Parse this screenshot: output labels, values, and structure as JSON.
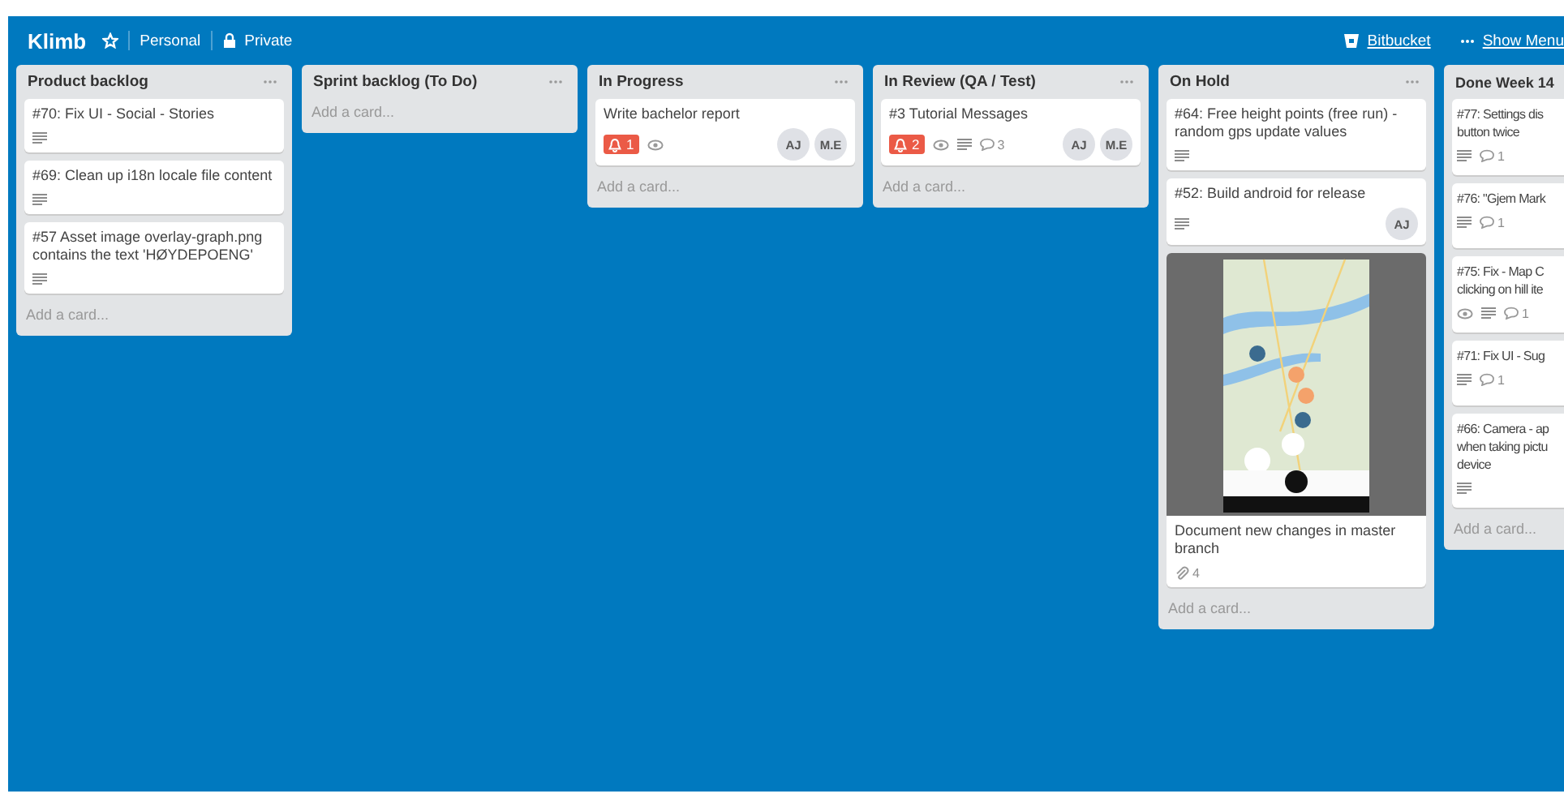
{
  "header": {
    "title": "Klimb",
    "links": [
      {
        "label": "Personal",
        "kind": "plain"
      },
      {
        "label": "Private",
        "kind": "lock"
      }
    ],
    "right": [
      {
        "label": "Bitbucket",
        "kind": "bitbucket"
      },
      {
        "label": "Show Menu",
        "kind": "more"
      }
    ]
  },
  "lists": [
    {
      "title": "Product backlog",
      "menu": true,
      "cards": [
        {
          "title": "#70: Fix UI - Social - Stories",
          "badges": [
            {
              "kind": "description"
            }
          ]
        },
        {
          "title": "#69: Clean up i18n locale file content",
          "badges": [
            {
              "kind": "description"
            }
          ]
        },
        {
          "title": "#57 Asset image overlay-graph.png contains the text 'HØYDEPOENG'",
          "badges": [
            {
              "kind": "description"
            }
          ]
        }
      ],
      "add": "Add a card..."
    },
    {
      "title": "Sprint backlog (To Do)",
      "menu": true,
      "add": "Add a card..."
    },
    {
      "title": "In Progress",
      "menu": true,
      "cards": [
        {
          "title": "Write bachelor report",
          "badges": [
            {
              "kind": "notification",
              "text": "1"
            },
            {
              "kind": "watch"
            }
          ],
          "members": [
            "AJ",
            "M.E"
          ]
        }
      ],
      "add": "Add a card..."
    },
    {
      "title": "In Review (QA / Test)",
      "menu": true,
      "cards": [
        {
          "title": "#3 Tutorial Messages",
          "badges": [
            {
              "kind": "notification",
              "text": "2"
            },
            {
              "kind": "watch"
            },
            {
              "kind": "description"
            },
            {
              "kind": "comments",
              "text": "3"
            }
          ],
          "members": [
            "AJ",
            "M.E"
          ]
        }
      ],
      "add": "Add a card..."
    },
    {
      "title": "On Hold",
      "menu": true,
      "cards": [
        {
          "title": "#64: Free height points (free run) - random gps update values",
          "badges": [
            {
              "kind": "description"
            }
          ]
        },
        {
          "title": "#52: Build android for release",
          "badges": [
            {
              "kind": "description"
            }
          ],
          "members": [
            "AJ"
          ]
        },
        {
          "cover": {
            "kind": "picture"
          },
          "title": "Document new changes in master branch",
          "badges": [
            {
              "kind": "attachments",
              "text": "4"
            }
          ]
        }
      ],
      "add": "Add a card..."
    },
    {
      "title": "Done Week 14",
      "menu": false,
      "cards": [
        {
          "title": "#77: Settings dis\nbutton twice",
          "badges": [
            {
              "kind": "description"
            },
            {
              "kind": "comments",
              "text": "1"
            }
          ]
        },
        {
          "title": "#76: \"Gjem Mark",
          "badges": [
            {
              "kind": "description"
            },
            {
              "kind": "comments",
              "text": "1"
            }
          ]
        },
        {
          "title": "#75: Fix - Map C\nclicking on hill ite",
          "badges": [
            {
              "kind": "watch"
            },
            {
              "kind": "description"
            },
            {
              "kind": "comments",
              "text": "1"
            }
          ]
        },
        {
          "title": "#71: Fix UI - Sug",
          "badges": [
            {
              "kind": "description"
            },
            {
              "kind": "comments",
              "text": "1"
            }
          ]
        },
        {
          "title": "#66: Camera - ap\nwhen taking pictu\ndevice",
          "badges": [
            {
              "kind": "description"
            }
          ]
        }
      ],
      "add": "Add a card..."
    }
  ]
}
